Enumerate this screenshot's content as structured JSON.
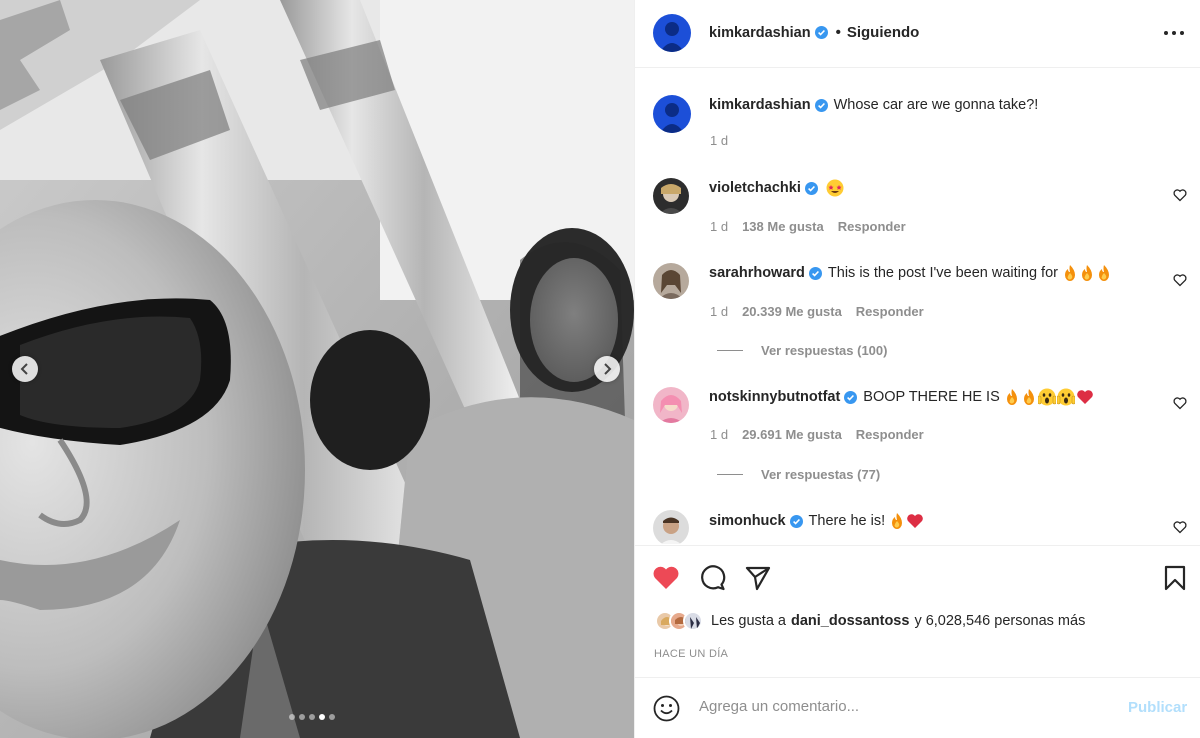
{
  "post": {
    "author": "kimkardashian",
    "follow_separator": "•",
    "follow_status": "Siguiendo",
    "caption_author": "kimkardashian",
    "caption": "Whose car are we gonna take?!",
    "caption_time": "1 d",
    "carousel_dots": 5,
    "active_dot": 4
  },
  "comments": [
    {
      "user": "violetchachki",
      "text": "",
      "emojis": [
        "star-struck"
      ],
      "time": "1 d",
      "likes": "138 Me gusta",
      "reply": "Responder",
      "replies": ""
    },
    {
      "user": "sarahrhoward",
      "text": "This is the post I've been waiting for",
      "emojis": [
        "fire",
        "fire",
        "fire"
      ],
      "time": "1 d",
      "likes": "20.339 Me gusta",
      "reply": "Responder",
      "replies": "Ver respuestas (100)"
    },
    {
      "user": "notskinnybutnotfat",
      "text": "BOOP THERE HE IS",
      "emojis": [
        "fire",
        "fire",
        "scream",
        "scream",
        "heart"
      ],
      "time": "1 d",
      "likes": "29.691 Me gusta",
      "reply": "Responder",
      "replies": "Ver respuestas (77)"
    },
    {
      "user": "simonhuck",
      "text": "There he is!",
      "emojis": [
        "fire",
        "heart"
      ],
      "time": "",
      "likes": "",
      "reply": "",
      "replies": ""
    }
  ],
  "likes_line": {
    "prefix": "Les gusta a",
    "user": "dani_dossantoss",
    "suffix": "y 6,028,546 personas más"
  },
  "when": "HACE UN DÍA",
  "composer": {
    "placeholder": "Agrega un comentario...",
    "publish": "Publicar"
  },
  "colors": {
    "liked_heart": "#ed4956",
    "verified": "#3897f0",
    "publish_disabled": "#b2dffc",
    "muted": "#8e8e8e"
  },
  "icons": [
    "chevron-left-icon",
    "chevron-right-icon",
    "more-icon",
    "verified-icon",
    "heart-icon",
    "comment-icon",
    "share-icon",
    "bookmark-icon",
    "emoji-icon"
  ]
}
